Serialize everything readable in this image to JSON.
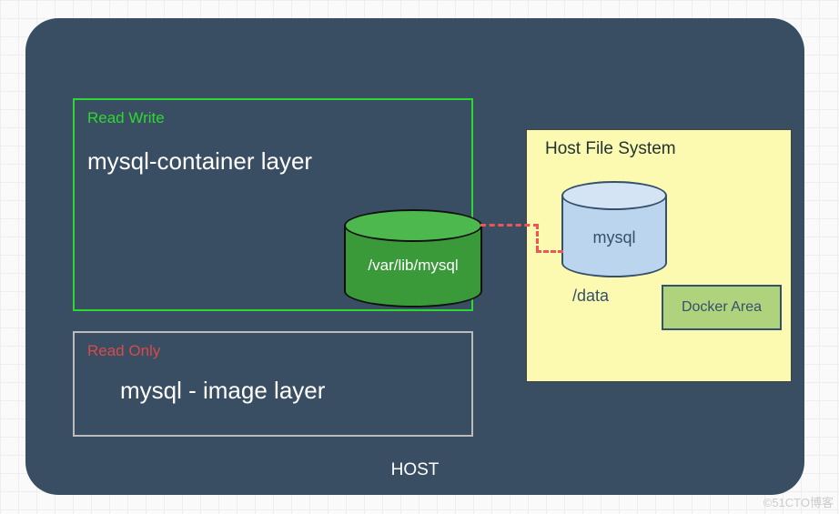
{
  "host": {
    "label": "HOST",
    "read_write": {
      "badge": "Read Write",
      "title": "mysql-container layer",
      "volume_path": "/var/lib/mysql"
    },
    "read_only": {
      "badge": "Read Only",
      "title": "mysql - image layer"
    },
    "file_system": {
      "title": "Host File System",
      "db_label": "mysql",
      "path": "/data",
      "docker_area": "Docker Area"
    }
  },
  "watermark": "©51CTO博客"
}
